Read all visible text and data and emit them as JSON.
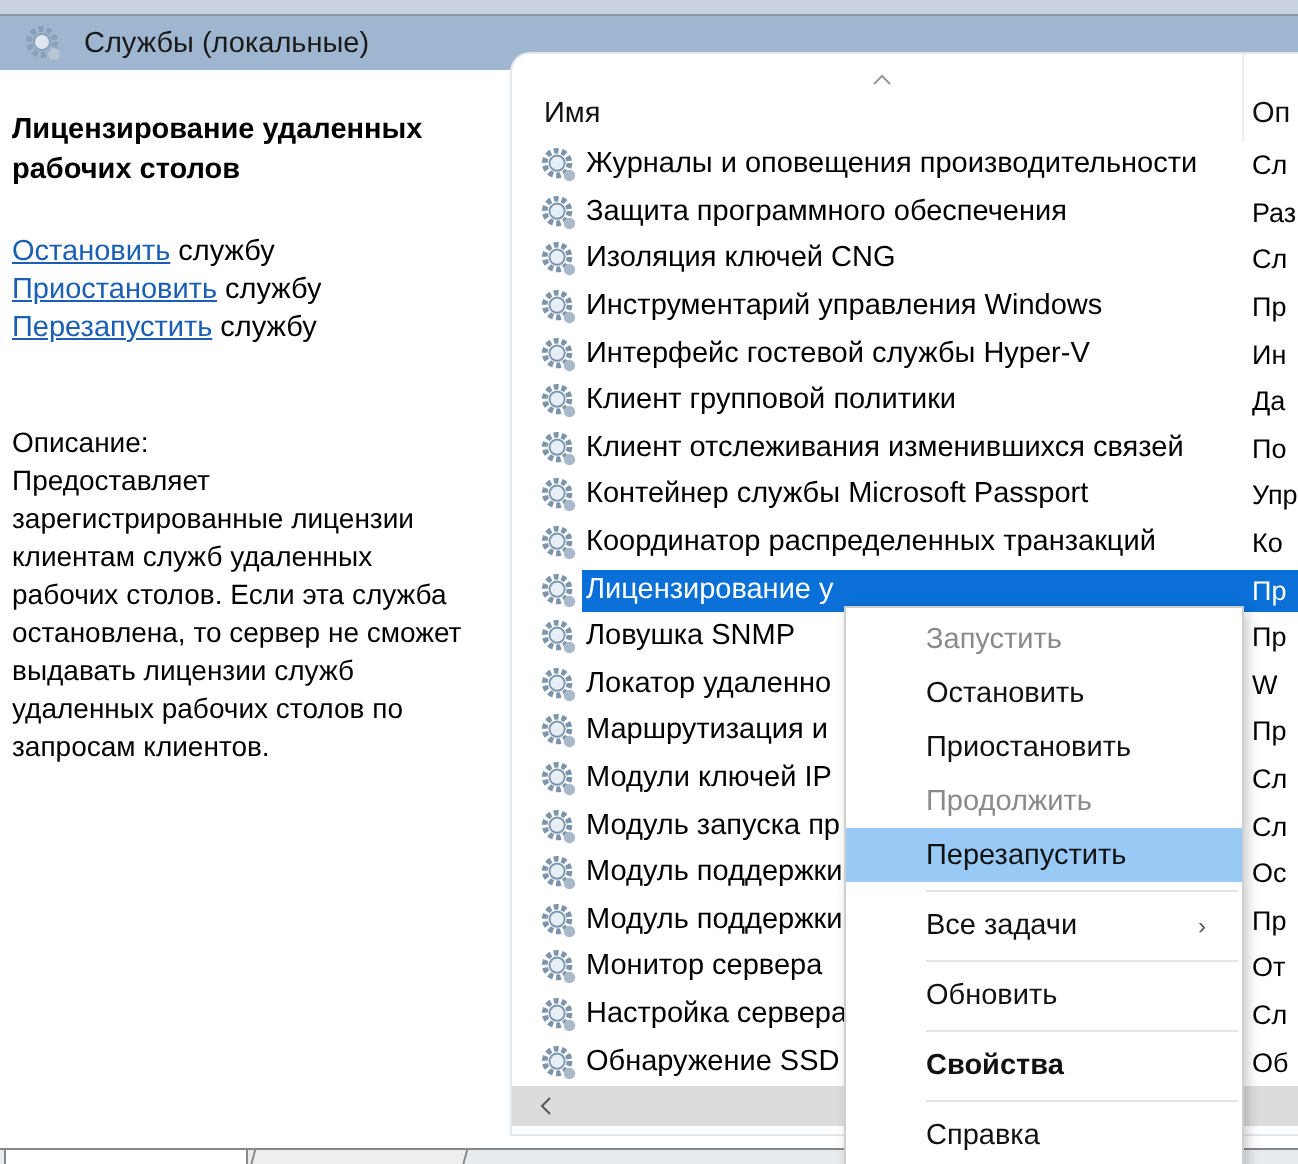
{
  "header": {
    "title": "Службы (локальные)"
  },
  "details": {
    "title": "Лицензирование удаленных рабочих столов",
    "actions": [
      {
        "link": "Остановить",
        "text": "службу"
      },
      {
        "link": "Приостановить",
        "text": "службу"
      },
      {
        "link": "Перезапустить",
        "text": "службу"
      }
    ],
    "description_label": "Описание:",
    "description": "Предоставляет зарегистрированные лицензии клиентам служб удаленных рабочих столов. Если эта служба остановлена, то сервер не сможет выдавать лицензии служб удаленных рабочих столов по запросам клиентов."
  },
  "table": {
    "columns": [
      "Имя",
      "Оп"
    ],
    "rows": [
      {
        "name": "Журналы и оповещения производительности",
        "column_2": "Сл",
        "selected": false
      },
      {
        "name": "Защита программного обеспечения",
        "column_2": "Раз",
        "selected": false
      },
      {
        "name": "Изоляция ключей CNG",
        "column_2": "Сл",
        "selected": false
      },
      {
        "name": "Инструментарий управления Windows",
        "column_2": "Пр",
        "selected": false
      },
      {
        "name": "Интерфейс гостевой службы Hyper-V",
        "column_2": "Ин",
        "selected": false
      },
      {
        "name": "Клиент групповой политики",
        "column_2": "Да",
        "selected": false
      },
      {
        "name": "Клиент отслеживания изменившихся связей",
        "column_2": "По",
        "selected": false
      },
      {
        "name": "Контейнер службы Microsoft Passport",
        "column_2": "Упр",
        "selected": false
      },
      {
        "name": "Координатор распределенных транзакций",
        "column_2": "Ко",
        "selected": false
      },
      {
        "name": "Лицензирование у",
        "column_2": "Пр",
        "selected": true
      },
      {
        "name": "Ловушка SNMP",
        "column_2": "Пр",
        "selected": false
      },
      {
        "name": "Локатор удаленно",
        "column_2": "W",
        "selected": false
      },
      {
        "name": "Маршрутизация и",
        "column_2": "Пр",
        "selected": false
      },
      {
        "name": "Модули ключей IP",
        "column_2": "Сл",
        "selected": false
      },
      {
        "name": "Модуль запуска пр",
        "column_2": "Сл",
        "selected": false
      },
      {
        "name": "Модуль поддержки",
        "column_2": "Ос",
        "selected": false
      },
      {
        "name": "Модуль поддержки",
        "column_2": "Пр",
        "selected": false
      },
      {
        "name": "Монитор сервера",
        "column_2": "От",
        "selected": false
      },
      {
        "name": "Настройка сервера",
        "column_2": "Сл",
        "selected": false
      },
      {
        "name": "Обнаружение SSD",
        "column_2": "Об",
        "selected": false
      }
    ]
  },
  "context_menu": [
    {
      "kind": "item",
      "label": "Запустить",
      "disabled": true,
      "selected": false
    },
    {
      "kind": "item",
      "label": "Остановить",
      "disabled": false,
      "selected": false
    },
    {
      "kind": "item",
      "label": "Приостановить",
      "disabled": false,
      "selected": false
    },
    {
      "kind": "item",
      "label": "Продолжить",
      "disabled": true,
      "selected": false
    },
    {
      "kind": "item",
      "label": "Перезапустить",
      "disabled": false,
      "selected": true
    },
    {
      "kind": "separator"
    },
    {
      "kind": "submenu",
      "label": "Все задачи",
      "arrow": "›",
      "disabled": false,
      "selected": false
    },
    {
      "kind": "separator"
    },
    {
      "kind": "item",
      "label": "Обновить",
      "disabled": false,
      "selected": false
    },
    {
      "kind": "separator"
    },
    {
      "kind": "default",
      "label": "Свойства",
      "disabled": false,
      "selected": false
    },
    {
      "kind": "separator"
    },
    {
      "kind": "item",
      "label": "Справка",
      "disabled": false,
      "selected": false
    }
  ]
}
